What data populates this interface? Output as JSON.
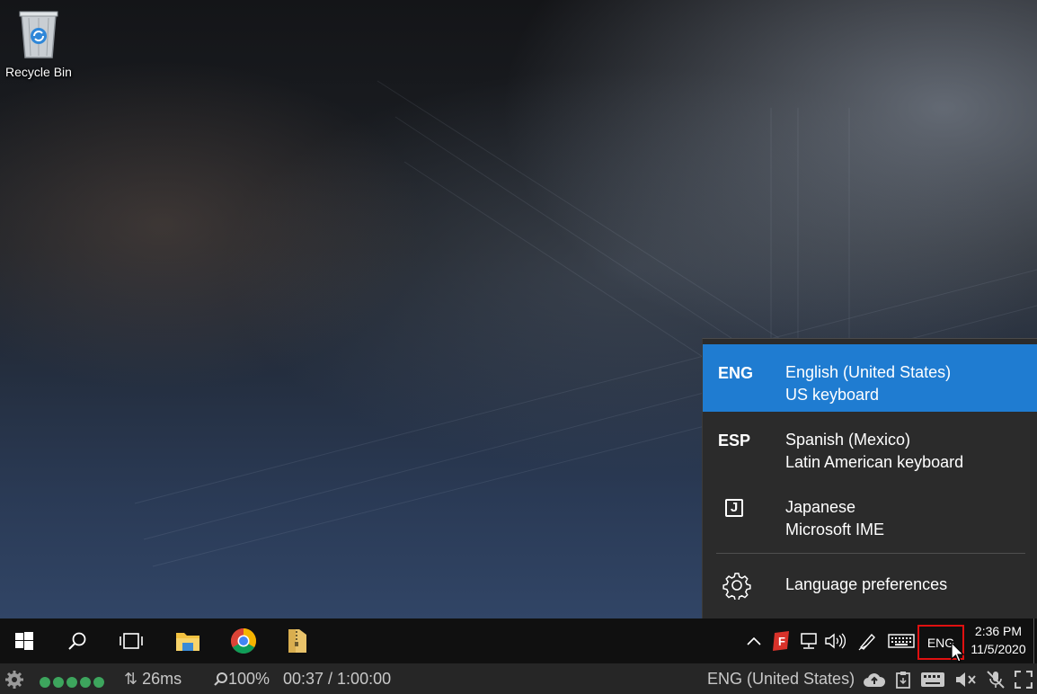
{
  "desktop": {
    "recycle_bin_label": "Recycle Bin"
  },
  "language_flyout": {
    "items": [
      {
        "code": "ENG",
        "language": "English (United States)",
        "keyboard": "US keyboard",
        "selected": true
      },
      {
        "code": "ESP",
        "language": "Spanish (Mexico)",
        "keyboard": "Latin American keyboard",
        "selected": false
      },
      {
        "code_icon": "ime-j-icon",
        "code_glyph": "J",
        "language": "Japanese",
        "keyboard": "Microsoft IME",
        "selected": false
      }
    ],
    "preferences_label": "Language preferences"
  },
  "taskbar": {
    "icons": [
      "start-windows-icon",
      "search-icon",
      "task-view-icon",
      "file-explorer-icon",
      "chrome-icon",
      "folder-zip-icon"
    ],
    "tray_icons": [
      "chevron-up-icon",
      "app-f-icon",
      "network-icon",
      "volume-icon",
      "pen-icon",
      "touch-keyboard-icon"
    ],
    "input_indicator": "ENG",
    "time": "2:36 PM",
    "date": "11/5/2020"
  },
  "status_bar": {
    "signal_dots": 5,
    "latency": "26ms",
    "zoom": "100%",
    "time_elapsed": "00:37 / 1:00:00",
    "keyboard_layout": "ENG (United States)"
  },
  "colors": {
    "accent": "#1f7cd1",
    "highlight_box": "#e01010",
    "signal_dot": "#3da55d"
  }
}
